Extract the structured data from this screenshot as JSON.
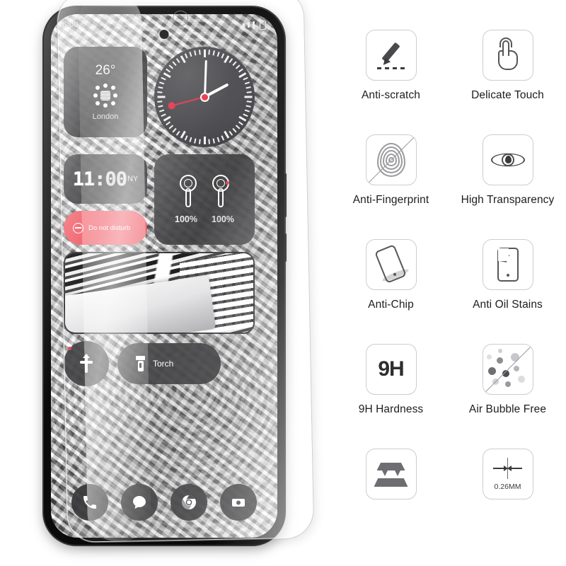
{
  "phone": {
    "statusbar": {
      "time": "6:00",
      "signal_icon": "signal-bars-icon",
      "battery_icon": "battery-icon"
    },
    "widgets": {
      "weather": {
        "temperature": "26°",
        "city": "London",
        "icon": "sun-icon"
      },
      "analog_clock": {
        "icon": "analog-clock-icon",
        "hour_deg": 62,
        "minute_deg": 2,
        "second_deg": 255
      },
      "digital_clock": {
        "time": "11:00",
        "timezone": "NY"
      },
      "do_not_disturb": {
        "label": "Do not disturb",
        "icon": "do-not-disturb-icon",
        "color": "#f0545f"
      },
      "earbuds": {
        "icon": "earbuds-icon",
        "left_battery": "100%",
        "right_battery": "100%"
      },
      "photo": {
        "icon": "photo-widget"
      },
      "flip_toggle": {
        "icon": "flip-arrow-icon"
      },
      "torch": {
        "label": "Torch",
        "icon": "torch-icon"
      }
    },
    "dock": [
      {
        "name": "dock-app-phone",
        "icon": "phone-icon"
      },
      {
        "name": "dock-app-messages",
        "icon": "message-bubble-icon"
      },
      {
        "name": "dock-app-chrome",
        "icon": "chrome-icon"
      },
      {
        "name": "dock-app-camera",
        "icon": "camera-icon"
      }
    ],
    "protector": {
      "name": "tempered-glass-protector"
    }
  },
  "features": [
    {
      "label": "Anti-scratch",
      "icon": "pen-scratch-icon",
      "slashed": false
    },
    {
      "label": "Delicate Touch",
      "icon": "finger-tap-icon",
      "slashed": false
    },
    {
      "label": "Anti-Fingerprint",
      "icon": "fingerprint-icon",
      "slashed": true
    },
    {
      "label": "High Transparency",
      "icon": "eye-icon",
      "slashed": false
    },
    {
      "label": "Anti-Chip",
      "icon": "phone-drop-icon",
      "slashed": false
    },
    {
      "label": "Anti Oil Stains",
      "icon": "phone-oil-stain-icon",
      "slashed": false
    },
    {
      "label": "9H Hardness",
      "icon": "hardness-9h-icon",
      "slashed": false,
      "badge_text": "9H"
    },
    {
      "label": "Air Bubble Free",
      "icon": "air-bubbles-icon",
      "slashed": true
    },
    {
      "label": "",
      "icon": "layered-glass-icon",
      "slashed": false
    },
    {
      "label": "",
      "icon": "thickness-icon",
      "slashed": false,
      "thickness_text": "0.26MM"
    }
  ],
  "colors": {
    "accent_red": "#e8384f",
    "dnd_red": "#f0545f",
    "icon_gray": "#57575b",
    "box_border": "#cdcdd0",
    "label_text": "#1d1d1f"
  }
}
